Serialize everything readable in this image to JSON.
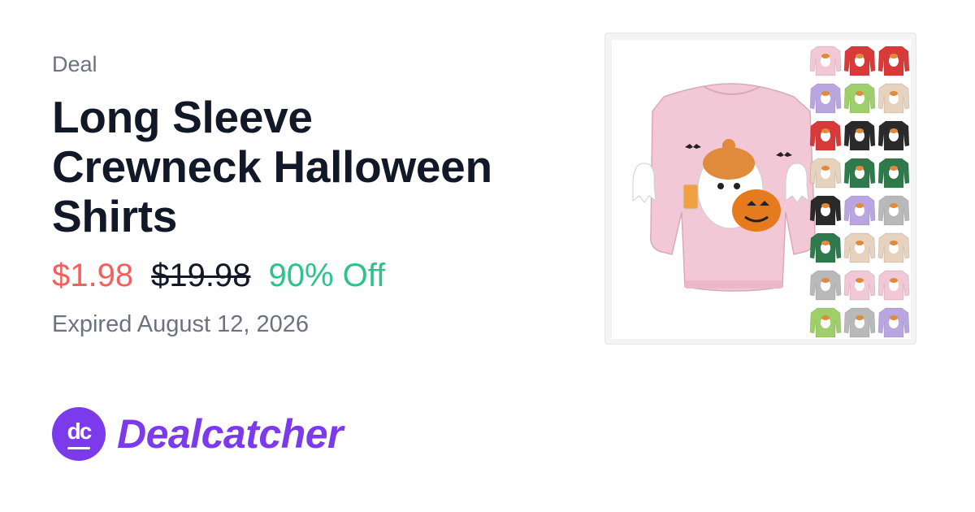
{
  "deal": {
    "eyebrow": "Deal",
    "title_lines": [
      "Long Sleeve",
      "Crewneck Halloween",
      "Shirts"
    ],
    "price_sale": "$1.98",
    "price_original": "$19.98",
    "discount": "90% Off",
    "expiry": "Expired August 12, 2026"
  },
  "brand": {
    "monogram": "dc",
    "name": "Dealcatcher",
    "color": "#7c3aed"
  },
  "product_image": {
    "main_color": "#f2c7d6",
    "swatches": [
      "#f2c7d6",
      "#d83a3a",
      "#d83a3a",
      "#b9a6e0",
      "#9fcf6a",
      "#e6d2bd",
      "#d83a3a",
      "#2a2a2a",
      "#2a2a2a",
      "#e6d2bd",
      "#2f7a4c",
      "#2f7a4c",
      "#2a2a2a",
      "#b9a6e0",
      "#b9b9b9",
      "#2f7a4c",
      "#e6d2bd",
      "#e6d2bd",
      "#b9b9b9",
      "#f2c7d6",
      "#f2c7d6",
      "#9fcf6a",
      "#b9b9b9",
      "#b9a6e0"
    ]
  }
}
